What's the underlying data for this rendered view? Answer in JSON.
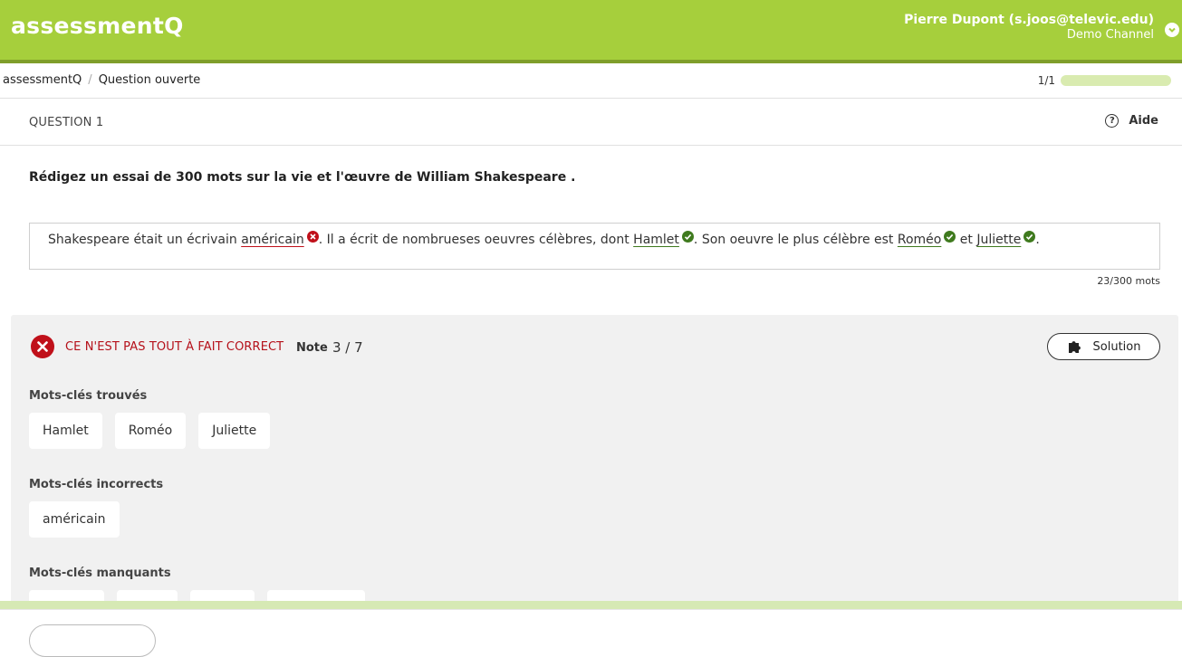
{
  "header": {
    "logo": "assessmentQ",
    "user_name": "Pierre Dupont (s.joos@televic.edu)",
    "channel": "Demo Channel",
    "dropdown_icon": "chevron-down-icon"
  },
  "breadcrumb": {
    "root": "assessmentQ",
    "separator": "/",
    "current": "Question ouverte"
  },
  "progress": {
    "label": "1/1",
    "fraction": 1.0
  },
  "question": {
    "label": "QUESTION 1",
    "help_label": "Aide",
    "prompt": "Rédigez un essai de 300 mots sur la vie et l'œuvre de William Shakespeare ."
  },
  "answer": {
    "part1": "Shakespeare était un écrivain ",
    "kw1": "américain",
    "part2": ". Il a écrit de nombrueses oeuvres célèbres, dont ",
    "kw2": "Hamlet",
    "part3": ". Son oeuvre le plus célèbre est ",
    "kw3": "Roméo",
    "part4": " et ",
    "kw4": "Juliette",
    "part5": ".",
    "word_count": "23/300 mots"
  },
  "feedback": {
    "status": "CE N'EST PAS TOUT À FAIT CORRECT",
    "grade_label": "Note",
    "grade_value": "3 / 7",
    "solution_label": "Solution",
    "found_title": "Mots-clés trouvés",
    "found": [
      "Hamlet",
      "Roméo",
      "Juliette"
    ],
    "incorrect_title": "Mots-clés incorrects",
    "incorrect": [
      "américain"
    ],
    "missing_title": "Mots-clés manquants"
  },
  "colors": {
    "brand": "#a6cf3c",
    "error": "#c0101a",
    "success": "#3f7a1e"
  }
}
